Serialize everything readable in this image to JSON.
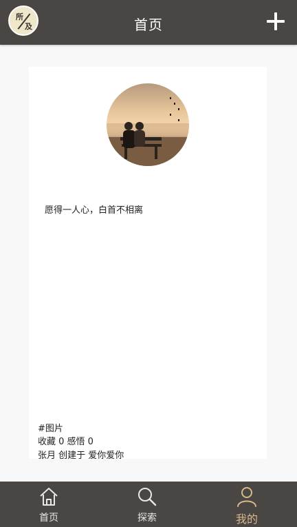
{
  "header": {
    "logo_text_1": "所",
    "logo_text_2": "及",
    "title": "首页",
    "add_icon": "plus-icon"
  },
  "post": {
    "image_icon": "couple-on-bench-photo",
    "quote": "愿得一人心，白首不相离",
    "tag": "#图片",
    "stats": "收藏 0 感悟 0",
    "creator": "张月 创建于 爱你爱你"
  },
  "nav": {
    "items": [
      {
        "label": "首页",
        "icon": "home-icon",
        "active": false
      },
      {
        "label": "探索",
        "icon": "search-icon",
        "active": false
      },
      {
        "label": "我的",
        "icon": "user-icon",
        "active": true
      }
    ]
  },
  "colors": {
    "bar_bg": "#4a4643",
    "active": "#d8b98a",
    "page_bg": "#f8f8f8"
  }
}
